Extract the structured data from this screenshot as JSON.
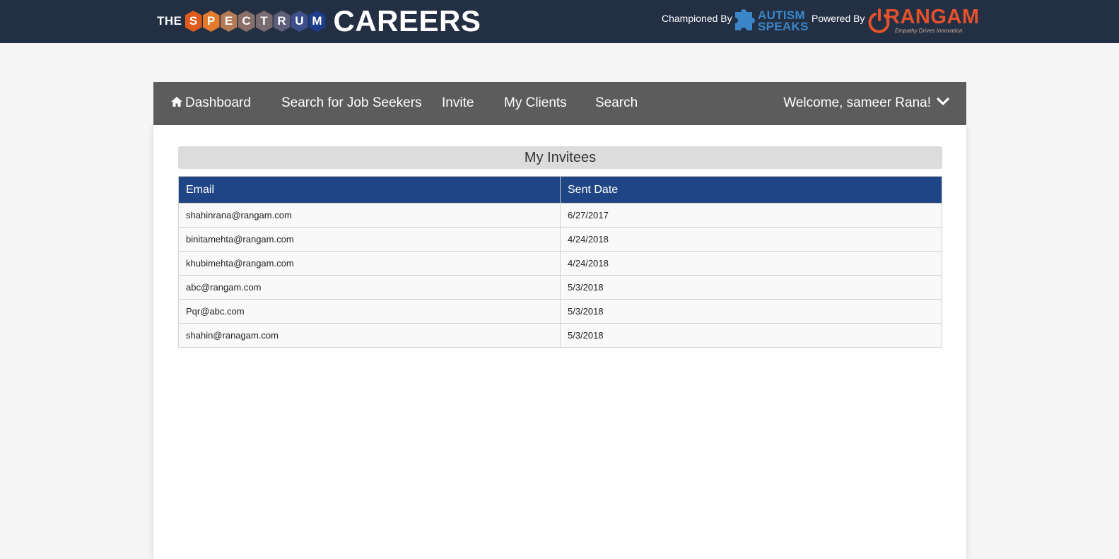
{
  "header": {
    "logo_prefix": "THE",
    "logo_letters": [
      "S",
      "P",
      "E",
      "C",
      "T",
      "R",
      "U",
      "M"
    ],
    "logo_hex_colors": [
      "#e05a1e",
      "#e37a2c",
      "#b37a56",
      "#8a6f68",
      "#7a6a72",
      "#5e5e7a",
      "#3d4f8a",
      "#1e3c8c"
    ],
    "logo_main": "CAREERS",
    "championed_by": "Championed By",
    "autism_line1": "AUTISM",
    "autism_line2": "SPEAKS",
    "powered_by": "Powered By",
    "rangam": "RANGAM",
    "rangam_tagline": "Empathy Drives Innovation"
  },
  "nav": {
    "dashboard": "Dashboard",
    "search_job_seekers": "Search for Job Seekers",
    "invite": "Invite",
    "my_clients": "My Clients",
    "search": "Search",
    "welcome": "Welcome, sameer Rana!"
  },
  "main": {
    "title": "My Invitees",
    "columns": [
      "Email",
      "Sent Date"
    ],
    "rows": [
      {
        "email": "shahinrana@rangam.com",
        "sent_date": "6/27/2017"
      },
      {
        "email": "binitamehta@rangam.com",
        "sent_date": "4/24/2018"
      },
      {
        "email": "khubimehta@rangam.com",
        "sent_date": "4/24/2018"
      },
      {
        "email": "abc@rangam.com",
        "sent_date": "5/3/2018"
      },
      {
        "email": "Pqr@abc.com",
        "sent_date": "5/3/2018"
      },
      {
        "email": "shahin@ranagam.com",
        "sent_date": "5/3/2018"
      }
    ]
  },
  "colors": {
    "header_bg": "#233044",
    "nav_bg": "#5c5c5c",
    "table_header_bg": "#1f4585",
    "autism_blue": "#3a86c8",
    "rangam_orange": "#e4512a"
  },
  "icons": {
    "home": "home-icon",
    "dropdown": "chevron-down-icon",
    "autism_logo": "puzzle-piece-icon",
    "rangam_logo": "power-ring-icon"
  }
}
